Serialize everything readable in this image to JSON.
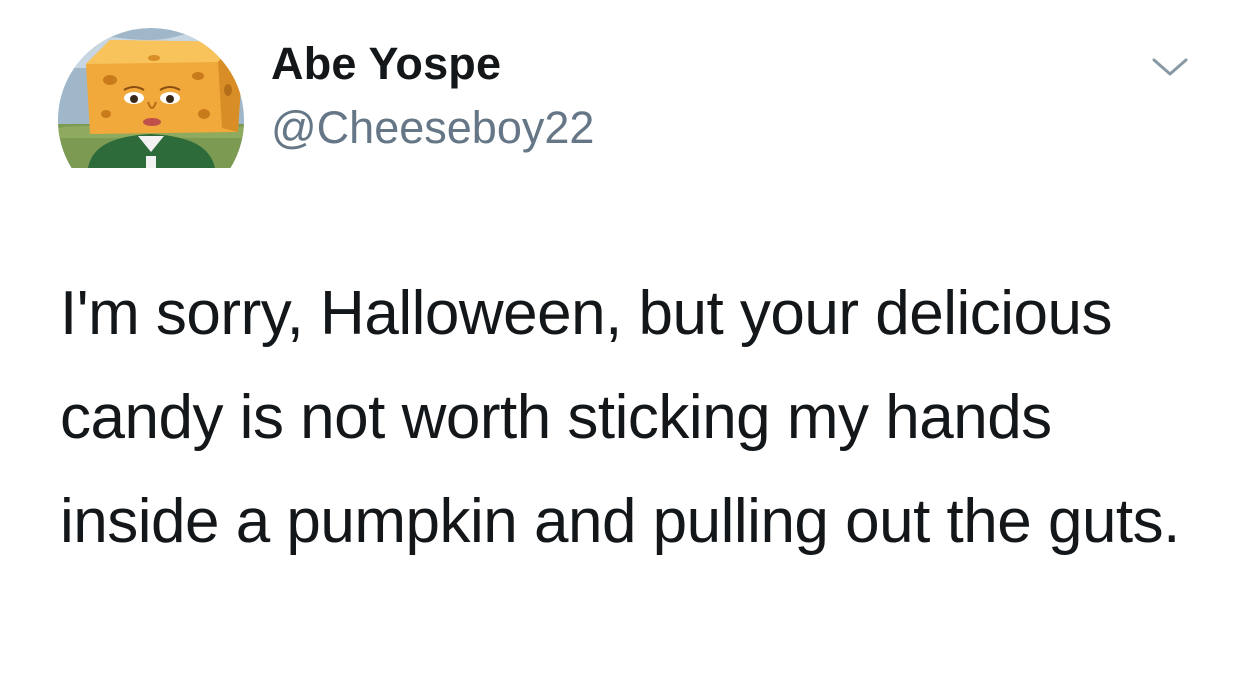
{
  "tweet": {
    "author": {
      "display_name": "Abe Yospe",
      "handle": "@Cheeseboy22",
      "avatar_icon": "cheese-head-avatar"
    },
    "menu_icon": "chevron-down-icon",
    "text": "I'm sorry, Halloween, but your delicious candy is not worth sticking my hands inside a pumpkin and pulling out the guts."
  },
  "colors": {
    "text_primary": "#14171a",
    "text_secondary": "#657786",
    "caret": "#8899a6",
    "background": "#ffffff"
  }
}
